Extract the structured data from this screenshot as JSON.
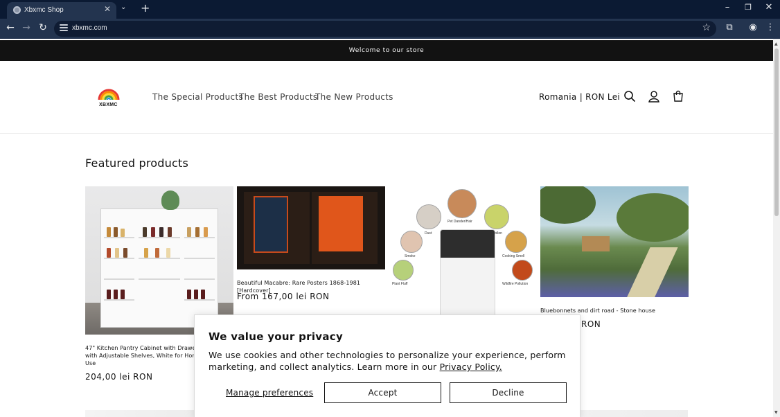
{
  "browser": {
    "tab_title": "Xbxmc Shop",
    "url": "xbxmc.com"
  },
  "announcement": "Welcome to our store",
  "header": {
    "logo_text": "XBXMC",
    "menu": [
      "The Special Products",
      "The Best Products",
      "The New Products"
    ],
    "locale": "Romania | RON Lei"
  },
  "featured": {
    "title": "Featured products",
    "products": [
      {
        "title": "47\" Kitchen Pantry Cabinet with Drawer, Cupboard with Adjustable Shelves, White for Home and Office Use",
        "price": "204,00 lei RON"
      },
      {
        "title": "Beautiful Macabre: Rare Posters 1868-1981 [Hardcover]",
        "price": "From 167,00 lei RON"
      },
      {
        "title": "",
        "price": ""
      },
      {
        "title": "Bluebonnets and dirt road - Stone house",
        "price": "RON"
      }
    ]
  },
  "purifier_labels": [
    "Pet Dander/Hair",
    "Dust",
    "Pollen",
    "Smoke",
    "Cooking Smell",
    "Plant Fluff",
    "Wildfire Pollution"
  ],
  "cookie": {
    "title": "We value your privacy",
    "text": "We use cookies and other technologies to personalize your experience, perform marketing, and collect analytics. Learn more in our",
    "link": "Privacy Policy.",
    "manage": "Manage preferences",
    "accept": "Accept",
    "decline": "Decline"
  },
  "colors": {
    "chrome_dark": "#0b1a33",
    "chrome": "#23344f",
    "announce_bg": "#121212"
  }
}
